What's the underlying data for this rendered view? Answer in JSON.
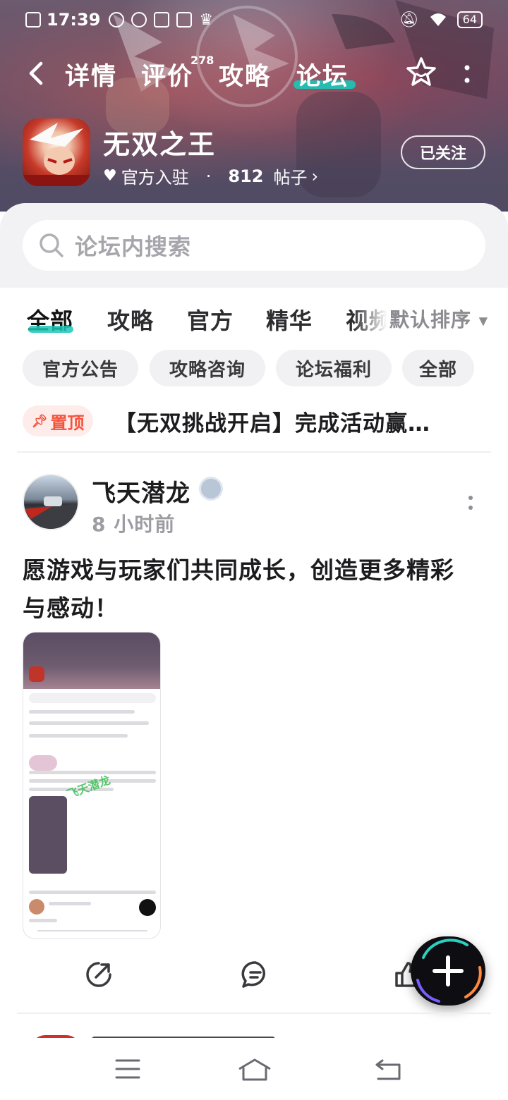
{
  "statusbar": {
    "time": "17:39",
    "battery": "64"
  },
  "nav": {
    "tabs": [
      {
        "label": "详情"
      },
      {
        "label": "评价",
        "badge": "278"
      },
      {
        "label": "攻略"
      },
      {
        "label": "论坛"
      }
    ],
    "active_tab": "论坛"
  },
  "game": {
    "title": "无双之王",
    "official_label": "官方入驻",
    "separator": "·",
    "post_count": "812",
    "post_unit": "帖子",
    "follow_label": "已关注"
  },
  "search": {
    "placeholder": "论坛内搜索"
  },
  "filter_tabs": {
    "items": [
      {
        "label": "全部"
      },
      {
        "label": "攻略"
      },
      {
        "label": "官方"
      },
      {
        "label": "精华"
      },
      {
        "label": "视频"
      }
    ],
    "sort_label": "默认排序"
  },
  "chips": [
    {
      "label": "官方公告"
    },
    {
      "label": "攻略咨询"
    },
    {
      "label": "论坛福利"
    },
    {
      "label": "全部"
    }
  ],
  "pinned": {
    "badge": "置顶",
    "text": "【无双挑战开启】完成活动赢…"
  },
  "post": {
    "author": "飞天潜龙",
    "time": "8 小时前",
    "body": "愿游戏与玩家们共同成长，创造更多精彩与感动！",
    "watermark": "飞天潜龙"
  },
  "icons": {
    "back": "chevron-left-icon",
    "favorite": "star-smile-icon",
    "more": "more-vertical-icon",
    "search": "search-icon",
    "share": "share-icon",
    "comment": "comment-icon",
    "like": "thumbs-up-icon",
    "fab": "plus-icon"
  },
  "colors": {
    "accent": "#1cc7b8",
    "pin": "#f3533c"
  }
}
